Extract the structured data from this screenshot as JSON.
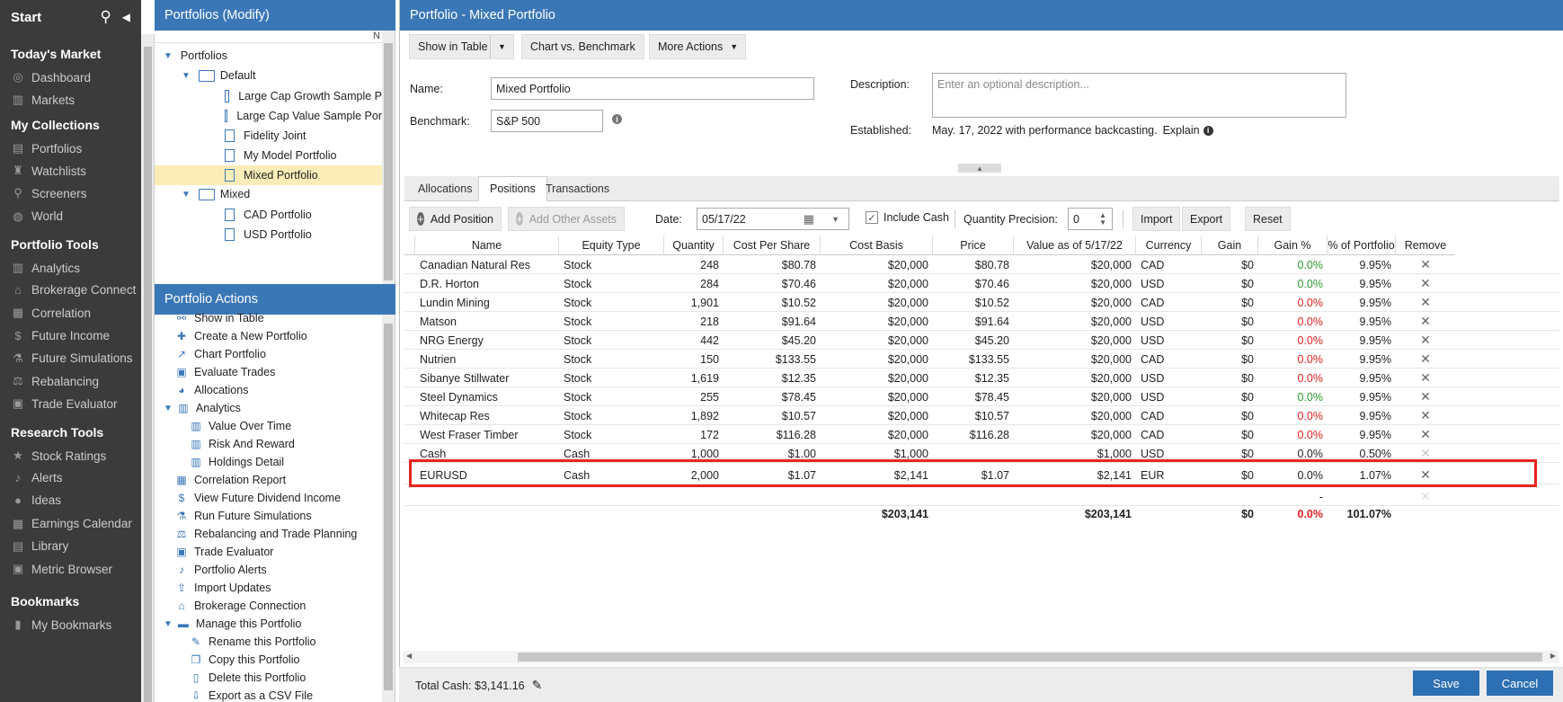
{
  "nav": {
    "start": "Start",
    "sections": [
      {
        "title": "Today's Market",
        "items": [
          {
            "icon": "dashboard-icon",
            "glyph": "◎",
            "label": "Dashboard"
          },
          {
            "icon": "markets-icon",
            "glyph": "▥",
            "label": "Markets"
          }
        ]
      },
      {
        "title": "My Collections",
        "items": [
          {
            "icon": "portfolios-icon",
            "glyph": "▤",
            "label": "Portfolios"
          },
          {
            "icon": "watchlists-icon",
            "glyph": "♜",
            "label": "Watchlists"
          },
          {
            "icon": "screeners-icon",
            "glyph": "⚲",
            "label": "Screeners"
          },
          {
            "icon": "world-icon",
            "glyph": "◍",
            "label": "World"
          }
        ]
      },
      {
        "title": "Portfolio Tools",
        "items": [
          {
            "icon": "analytics-icon",
            "glyph": "▥",
            "label": "Analytics"
          },
          {
            "icon": "brokerage-icon",
            "glyph": "⌂",
            "label": "Brokerage Connect"
          },
          {
            "icon": "correlation-icon",
            "glyph": "▦",
            "label": "Correlation"
          },
          {
            "icon": "future-income-icon",
            "glyph": "$",
            "label": "Future Income"
          },
          {
            "icon": "future-simulations-icon",
            "glyph": "⚗",
            "label": "Future Simulations"
          },
          {
            "icon": "rebalancing-icon",
            "glyph": "⚖",
            "label": "Rebalancing"
          },
          {
            "icon": "trade-evaluator-icon",
            "glyph": "▣",
            "label": "Trade Evaluator"
          }
        ]
      },
      {
        "title": "Research Tools",
        "items": [
          {
            "icon": "stock-ratings-icon",
            "glyph": "★",
            "label": "Stock Ratings"
          },
          {
            "icon": "alerts-icon",
            "glyph": "♪",
            "label": "Alerts"
          },
          {
            "icon": "ideas-icon",
            "glyph": "●",
            "label": "Ideas"
          },
          {
            "icon": "earnings-calendar-icon",
            "glyph": "▦",
            "label": "Earnings Calendar"
          },
          {
            "icon": "library-icon",
            "glyph": "▤",
            "label": "Library"
          },
          {
            "icon": "metric-browser-icon",
            "glyph": "▣",
            "label": "Metric Browser"
          }
        ]
      },
      {
        "title": "Bookmarks",
        "items": [
          {
            "icon": "bookmark-icon",
            "glyph": "▮",
            "label": "My Bookmarks"
          }
        ]
      }
    ]
  },
  "tree": {
    "header": "Portfolios (Modify)",
    "col_hint": "N",
    "root": "Portfolios",
    "folders": [
      {
        "label": "Default",
        "items": [
          "Large Cap Growth Sample P",
          "Large Cap Value Sample Por",
          "Fidelity Joint",
          "My Model Portfolio",
          "Mixed Portfolio"
        ]
      },
      {
        "label": "Mixed",
        "items": [
          "CAD Portfolio",
          "USD Portfolio"
        ]
      }
    ]
  },
  "actions": {
    "header": "Portfolio Actions",
    "items": [
      {
        "label": "Show in Table",
        "glyph": "⚯",
        "indent": 0
      },
      {
        "label": "Create a New Portfolio",
        "glyph": "✚",
        "indent": 0
      },
      {
        "label": "Chart Portfolio",
        "glyph": "↗",
        "indent": 0
      },
      {
        "label": "Evaluate Trades",
        "glyph": "▣",
        "indent": 0
      },
      {
        "label": "Allocations",
        "glyph": "◕",
        "indent": 0
      },
      {
        "label": "Analytics",
        "glyph": "▥",
        "indent": 0
      },
      {
        "label": "Value Over Time",
        "glyph": "▥",
        "indent": 1
      },
      {
        "label": "Risk And Reward",
        "glyph": "▥",
        "indent": 1
      },
      {
        "label": "Holdings Detail",
        "glyph": "▥",
        "indent": 1
      },
      {
        "label": "Correlation Report",
        "glyph": "▦",
        "indent": 0
      },
      {
        "label": "View Future Dividend Income",
        "glyph": "$",
        "indent": 0
      },
      {
        "label": "Run Future Simulations",
        "glyph": "⚗",
        "indent": 0
      },
      {
        "label": "Rebalancing and Trade Planning",
        "glyph": "⚖",
        "indent": 0
      },
      {
        "label": "Trade Evaluator",
        "glyph": "▣",
        "indent": 0
      },
      {
        "label": "Portfolio Alerts",
        "glyph": "♪",
        "indent": 0
      },
      {
        "label": "Import Updates",
        "glyph": "⇪",
        "indent": 0
      },
      {
        "label": "Brokerage Connection",
        "glyph": "⌂",
        "indent": 0
      },
      {
        "label": "Manage this Portfolio",
        "glyph": "▬",
        "indent": 0
      },
      {
        "label": "Rename this Portfolio",
        "glyph": "✎",
        "indent": 1
      },
      {
        "label": "Copy this Portfolio",
        "glyph": "❐",
        "indent": 1
      },
      {
        "label": "Delete this Portfolio",
        "glyph": "▯",
        "indent": 1
      },
      {
        "label": "Export as a CSV File",
        "glyph": "⇩",
        "indent": 1
      }
    ]
  },
  "main": {
    "header": "Portfolio - Mixed Portfolio",
    "toolbar": {
      "show_in_table": "Show in Table",
      "chart_vs_benchmark": "Chart vs. Benchmark",
      "more_actions": "More Actions"
    },
    "form": {
      "name_label": "Name:",
      "name_value": "Mixed Portfolio",
      "benchmark_label": "Benchmark:",
      "benchmark_value": "S&P 500",
      "description_label": "Description:",
      "description_placeholder": "Enter an optional description...",
      "established_label": "Established:",
      "established_value": "May. 17, 2022 with performance backcasting.",
      "explain": "Explain"
    },
    "tabs": [
      "Allocations",
      "Positions",
      "Transactions"
    ],
    "active_tab": "Positions",
    "positions_toolbar": {
      "add_position": "Add Position",
      "add_other_assets": "Add Other Assets",
      "date_label": "Date:",
      "date_value": "05/17/22",
      "include_cash": "Include Cash",
      "qty_precision_label": "Quantity Precision:",
      "qty_precision_value": "0",
      "import": "Import",
      "export": "Export",
      "reset": "Reset"
    },
    "columns": [
      "Name",
      "Equity Type",
      "Quantity",
      "Cost Per Share",
      "Cost Basis",
      "Price",
      "Value as of 5/17/22",
      "Currency",
      "Gain",
      "Gain %",
      "% of Portfolio",
      "Remove"
    ],
    "rows": [
      [
        "Canadian Natural Res",
        "Stock",
        "248",
        "$80.78",
        "$20,000",
        "$80.78",
        "$20,000",
        "CAD",
        "$0",
        "0.0%",
        "9.95%",
        "green"
      ],
      [
        "D.R. Horton",
        "Stock",
        "284",
        "$70.46",
        "$20,000",
        "$70.46",
        "$20,000",
        "USD",
        "$0",
        "0.0%",
        "9.95%",
        "green"
      ],
      [
        "Lundin Mining",
        "Stock",
        "1,901",
        "$10.52",
        "$20,000",
        "$10.52",
        "$20,000",
        "CAD",
        "$0",
        "0.0%",
        "9.95%",
        "red"
      ],
      [
        "Matson",
        "Stock",
        "218",
        "$91.64",
        "$20,000",
        "$91.64",
        "$20,000",
        "USD",
        "$0",
        "0.0%",
        "9.95%",
        "red"
      ],
      [
        "NRG Energy",
        "Stock",
        "442",
        "$45.20",
        "$20,000",
        "$45.20",
        "$20,000",
        "USD",
        "$0",
        "0.0%",
        "9.95%",
        "red"
      ],
      [
        "Nutrien",
        "Stock",
        "150",
        "$133.55",
        "$20,000",
        "$133.55",
        "$20,000",
        "CAD",
        "$0",
        "0.0%",
        "9.95%",
        "red"
      ],
      [
        "Sibanye Stillwater",
        "Stock",
        "1,619",
        "$12.35",
        "$20,000",
        "$12.35",
        "$20,000",
        "USD",
        "$0",
        "0.0%",
        "9.95%",
        "red"
      ],
      [
        "Steel Dynamics",
        "Stock",
        "255",
        "$78.45",
        "$20,000",
        "$78.45",
        "$20,000",
        "USD",
        "$0",
        "0.0%",
        "9.95%",
        "green"
      ],
      [
        "Whitecap Res",
        "Stock",
        "1,892",
        "$10.57",
        "$20,000",
        "$10.57",
        "$20,000",
        "CAD",
        "$0",
        "0.0%",
        "9.95%",
        "red"
      ],
      [
        "West Fraser Timber",
        "Stock",
        "172",
        "$116.28",
        "$20,000",
        "$116.28",
        "$20,000",
        "CAD",
        "$0",
        "0.0%",
        "9.95%",
        "red"
      ],
      [
        "Cash",
        "Cash",
        "1,000",
        "$1.00",
        "$1,000",
        "",
        "$1,000",
        "USD",
        "$0",
        "0.0%",
        "0.50%",
        "plain"
      ],
      [
        "EURUSD",
        "Cash",
        "2,000",
        "$1.07",
        "$2,141",
        "$1.07",
        "$2,141",
        "EUR",
        "$0",
        "0.0%",
        "1.07%",
        "plain"
      ]
    ],
    "blank_row_gain_pct": "-",
    "totals": {
      "cost_basis": "$203,141",
      "value": "$203,141",
      "gain": "$0",
      "gain_pct": "0.0%",
      "pct": "101.07%"
    },
    "footer": {
      "total_cash": "Total Cash: $3,141.16",
      "save": "Save",
      "cancel": "Cancel"
    }
  },
  "colors": {
    "header_blue": "#3a77b7",
    "nav_bg": "#3b3b3b",
    "selected_row": "#fbedb8",
    "highlight_box": "#e8261d",
    "gain_green": "#2a9a2a",
    "loss_red": "#e02020"
  }
}
